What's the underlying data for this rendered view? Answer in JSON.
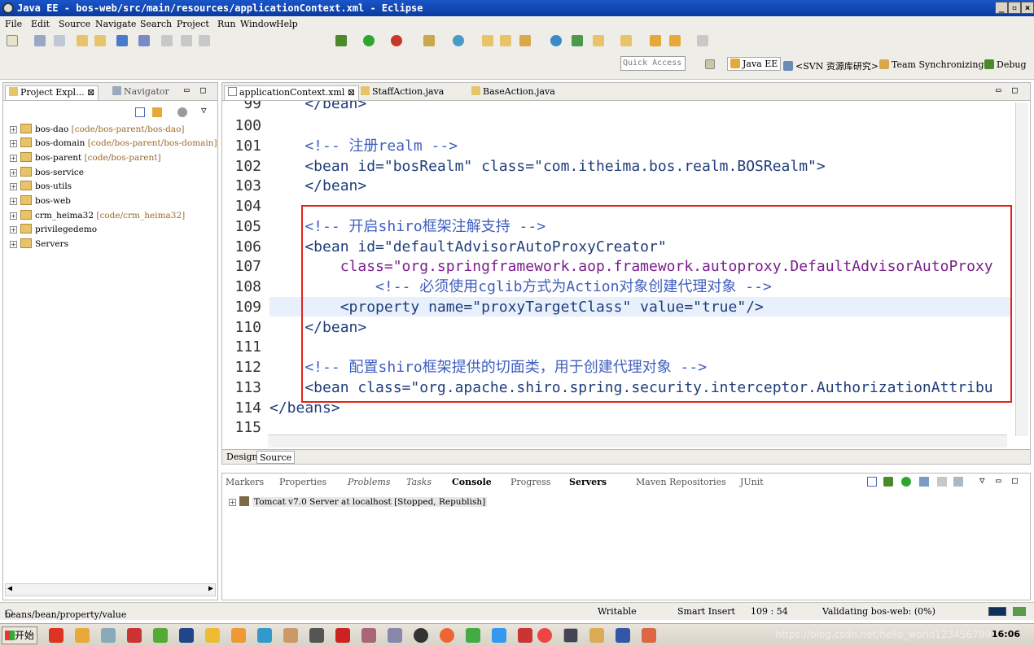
{
  "window": {
    "title": "Java EE - bos-web/src/main/resources/applicationContext.xml - Eclipse",
    "min": "_",
    "max": "▫",
    "close": "×"
  },
  "menu": [
    "File",
    "Edit",
    "Source",
    "Navigate",
    "Search",
    "Project",
    "Run",
    "Window",
    "Help"
  ],
  "toolbar": {
    "quick_access": "Quick Access",
    "perspectives": [
      "Java EE",
      "<SVN 资源库研究>",
      "Team Synchronizing",
      "Debug"
    ]
  },
  "left_panel": {
    "tabs": [
      "Project Expl...",
      "Navigator"
    ],
    "tree": [
      {
        "name": "bos-dao",
        "deco": "[code/bos-parent/bos-dao]"
      },
      {
        "name": "bos-domain",
        "deco": "[code/bos-parent/bos-domain]"
      },
      {
        "name": "bos-parent",
        "deco": "[code/bos-parent]"
      },
      {
        "name": "bos-service",
        "deco": ""
      },
      {
        "name": "bos-utils",
        "deco": ""
      },
      {
        "name": "bos-web",
        "deco": ""
      },
      {
        "name": "crm_heima32",
        "deco": "[code/crm_heima32]"
      },
      {
        "name": "privilegedemo",
        "deco": ""
      },
      {
        "name": "Servers",
        "deco": ""
      }
    ]
  },
  "editor": {
    "tabs": [
      "applicationContext.xml",
      "StaffAction.java",
      "BaseAction.java"
    ],
    "lines": [
      {
        "n": "99",
        "text": "    </bean>"
      },
      {
        "n": "100",
        "text": ""
      },
      {
        "n": "101",
        "text": "    <!-- 注册realm -->"
      },
      {
        "n": "102",
        "text": "    <bean id=\"bosRealm\" class=\"com.itheima.bos.realm.BOSRealm\">"
      },
      {
        "n": "103",
        "text": "    </bean>"
      },
      {
        "n": "104",
        "text": ""
      },
      {
        "n": "105",
        "text": "    <!-- 开启shiro框架注解支持 -->"
      },
      {
        "n": "106",
        "text": "    <bean id=\"defaultAdvisorAutoProxyCreator\""
      },
      {
        "n": "107",
        "text": "        class=\"org.springframework.aop.framework.autoproxy.DefaultAdvisorAutoProxy"
      },
      {
        "n": "108",
        "text": "            <!-- 必须使用cglib方式为Action对象创建代理对象 -->"
      },
      {
        "n": "109",
        "text": "        <property name=\"proxyTargetClass\" value=\"true\"/>"
      },
      {
        "n": "110",
        "text": "    </bean>"
      },
      {
        "n": "111",
        "text": ""
      },
      {
        "n": "112",
        "text": "    <!-- 配置shiro框架提供的切面类，用于创建代理对象 -->"
      },
      {
        "n": "113",
        "text": "    <bean class=\"org.apache.shiro.spring.security.interceptor.AuthorizationAttribu"
      },
      {
        "n": "114",
        "text": "</beans>"
      },
      {
        "n": "115",
        "text": ""
      }
    ],
    "bottom_tabs": [
      "Design",
      "Source"
    ]
  },
  "bottom_panel": {
    "tabs": [
      "Markers",
      "Properties",
      "Problems",
      "Tasks",
      "Console",
      "Progress",
      "Servers",
      "Maven Repositories",
      "JUnit"
    ],
    "active_tab": "Servers",
    "server_row": "Tomcat v7.0 Server at localhost  [Stopped, Republish]"
  },
  "status": {
    "path": "beans/bean/property/value",
    "writable": "Writable",
    "insert": "Smart Insert",
    "position": "109 : 54",
    "validating": "Validating bos-web: (0%)"
  },
  "taskbar": {
    "start": "开始",
    "watermark": "https://blog.csdn.net/hello_world123456789",
    "clock": "16:06"
  },
  "colors": {
    "title_bar": "#0a3aa0",
    "highlight_box": "#e3241c",
    "tag": "#1f3d7a",
    "attr": "#7a1f8c",
    "string": "#2a00ff",
    "comment": "#3f5fbf"
  }
}
